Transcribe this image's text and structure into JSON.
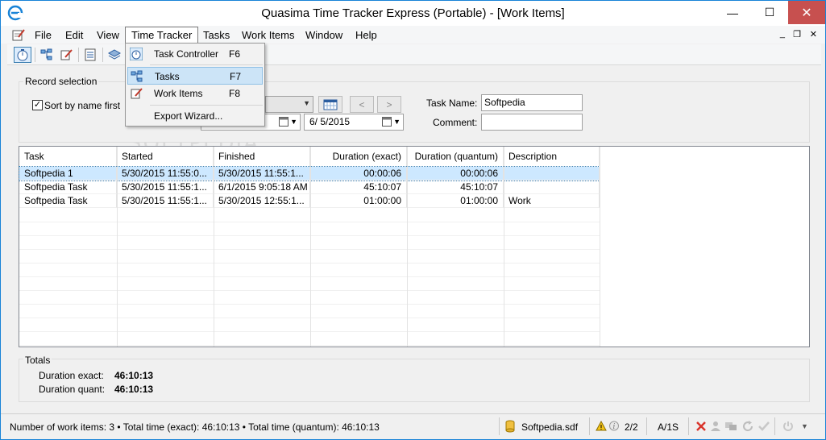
{
  "window": {
    "title": "Quasima Time Tracker Express (Portable) - [Work Items]",
    "minimize": "—",
    "maximize": "☐",
    "close": "✕"
  },
  "menu": {
    "items": [
      "File",
      "Edit",
      "View",
      "Time Tracker",
      "Tasks",
      "Work Items",
      "Window",
      "Help"
    ],
    "mdi_min": "_",
    "mdi_restore": "❐",
    "mdi_close": "✕"
  },
  "dropdown": {
    "items": [
      {
        "label": "Task Controller",
        "key": "F6",
        "icon": "stopwatch-icon"
      },
      {
        "label": "Tasks",
        "key": "F7",
        "icon": "tasks-tree-icon"
      },
      {
        "label": "Work Items",
        "key": "F8",
        "icon": "edit-doc-icon"
      },
      {
        "label": "Export Wizard...",
        "key": "",
        "icon": ""
      }
    ]
  },
  "record_selection": {
    "title": "Record selection",
    "sort_label": "Sort by name first",
    "sort_checked": "✓",
    "date_to": "6/  5/2015",
    "prev": "<",
    "next": ">",
    "task_name_label": "Task Name:",
    "task_name_value": "Softpedia",
    "comment_label": "Comment:",
    "comment_value": ""
  },
  "grid": {
    "columns": [
      "Task",
      "Started",
      "Finished",
      "Duration (exact)",
      "Duration (quantum)",
      "Description"
    ],
    "rows": [
      [
        "Softpedia 1",
        "5/30/2015 11:55:0...",
        "5/30/2015 11:55:1...",
        "00:00:06",
        "00:00:06",
        ""
      ],
      [
        "Softpedia Task",
        "5/30/2015 11:55:1...",
        "6/1/2015 9:05:18 AM",
        "45:10:07",
        "45:10:07",
        ""
      ],
      [
        "Softpedia Task",
        "5/30/2015 11:55:1...",
        "5/30/2015 12:55:1...",
        "01:00:00",
        "01:00:00",
        "Work"
      ]
    ]
  },
  "totals": {
    "title": "Totals",
    "exact_label": "Duration exact:",
    "exact_value": "46:10:13",
    "quant_label": "Duration quant:",
    "quant_value": "46:10:13"
  },
  "status": {
    "summary": "Number of work items: 3 • Total time (exact): 46:10:13 • Total time (quantum): 46:10:13",
    "db_file": "Softpedia.sdf",
    "pages": "2/2",
    "mode": "A/1S"
  },
  "watermark": "SOFTPEDIA",
  "colors": {
    "accent": "#1883d7",
    "selection": "#cde8ff",
    "close_red": "#c7504f"
  }
}
